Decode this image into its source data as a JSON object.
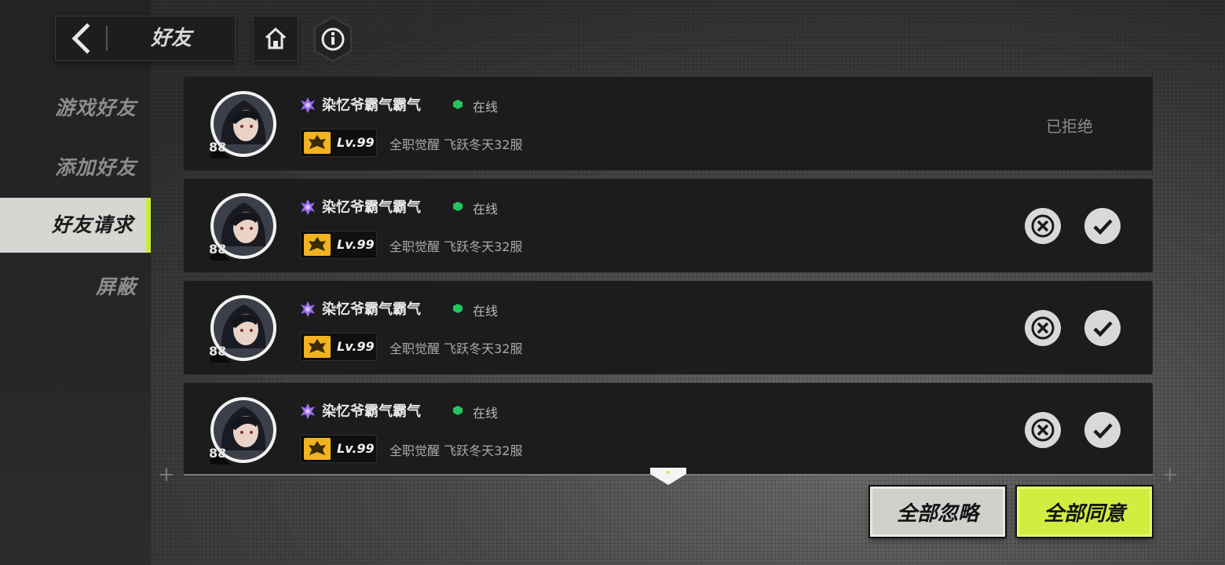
{
  "header": {
    "title": "好友",
    "back_icon": "chevron-left-icon",
    "home_icon": "home-icon",
    "info_icon": "info-icon"
  },
  "sidebar": {
    "items": [
      {
        "label": "游戏好友",
        "active": false
      },
      {
        "label": "添加好友",
        "active": false
      },
      {
        "label": "好友请求",
        "active": true
      },
      {
        "label": "屏蔽",
        "active": false
      }
    ]
  },
  "colors": {
    "accent": "#c8ec3c",
    "online": "#22c55e",
    "name_icon": "#9d6bf0",
    "level_icon": "#f2b321"
  },
  "requests": [
    {
      "avatar_level": "88",
      "name": "染忆爷霸气霸气",
      "status": "在线",
      "level": "Lv.99",
      "server": "全职觉醒 飞跃冬天32服",
      "state": "已拒绝"
    },
    {
      "avatar_level": "88",
      "name": "染忆爷霸气霸气",
      "status": "在线",
      "level": "Lv.99",
      "server": "全职觉醒 飞跃冬天32服",
      "state": "pending"
    },
    {
      "avatar_level": "88",
      "name": "染忆爷霸气霸气",
      "status": "在线",
      "level": "Lv.99",
      "server": "全职觉醒 飞跃冬天32服",
      "state": "pending"
    },
    {
      "avatar_level": "88",
      "name": "染忆爷霸气霸气",
      "status": "在线",
      "level": "Lv.99",
      "server": "全职觉醒 飞跃冬天32服",
      "state": "pending"
    }
  ],
  "actions": {
    "ignore_all": "全部忽略",
    "agree_all": "全部同意"
  }
}
